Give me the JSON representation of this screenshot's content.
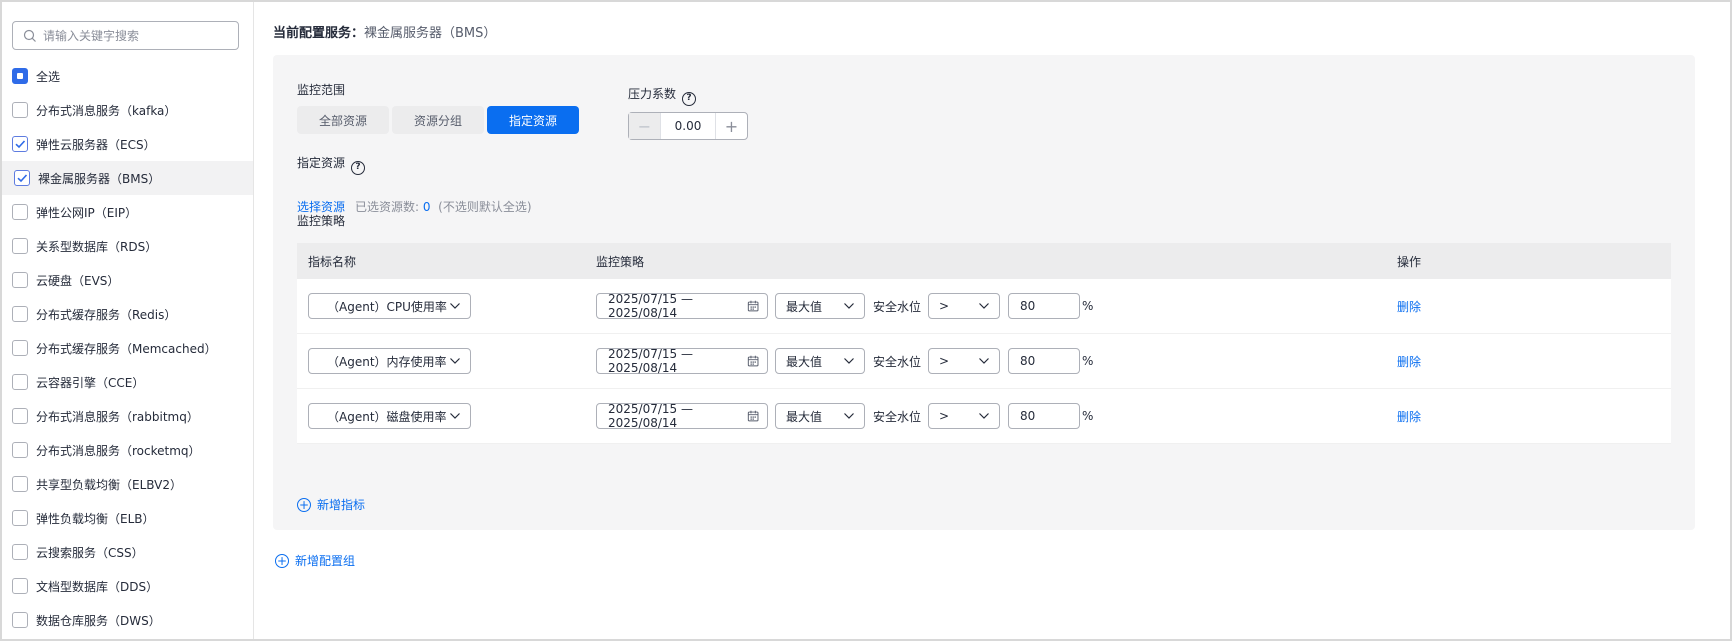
{
  "sidebar": {
    "search_placeholder": "请输入关键字搜索",
    "items": [
      {
        "label": "全选",
        "state": "indeterminate"
      },
      {
        "label": "分布式消息服务（kafka）",
        "state": "unchecked"
      },
      {
        "label": "弹性云服务器（ECS）",
        "state": "checked"
      },
      {
        "label": "裸金属服务器（BMS）",
        "state": "checked"
      },
      {
        "label": "弹性公网IP（EIP）",
        "state": "unchecked"
      },
      {
        "label": "关系型数据库（RDS）",
        "state": "unchecked"
      },
      {
        "label": "云硬盘（EVS）",
        "state": "unchecked"
      },
      {
        "label": "分布式缓存服务（Redis）",
        "state": "unchecked"
      },
      {
        "label": "分布式缓存服务（Memcached）",
        "state": "unchecked"
      },
      {
        "label": "云容器引擎（CCE）",
        "state": "unchecked"
      },
      {
        "label": "分布式消息服务（rabbitmq）",
        "state": "unchecked"
      },
      {
        "label": "分布式消息服务（rocketmq）",
        "state": "unchecked"
      },
      {
        "label": "共享型负载均衡（ELBV2）",
        "state": "unchecked"
      },
      {
        "label": "弹性负载均衡（ELB）",
        "state": "unchecked"
      },
      {
        "label": "云搜索服务（CSS）",
        "state": "unchecked"
      },
      {
        "label": "文档型数据库（DDS）",
        "state": "unchecked"
      },
      {
        "label": "数据仓库服务（DWS）",
        "state": "unchecked"
      }
    ]
  },
  "main": {
    "current_label": "当前配置服务：",
    "current_value": "裸金属服务器（BMS）",
    "scope_label": "监控范围",
    "scope_options": [
      "全部资源",
      "资源分组",
      "指定资源"
    ],
    "scope_active": 2,
    "pressure_label": "压力系数",
    "pressure_value": "0.00",
    "specified_label": "指定资源",
    "select_link": "选择资源",
    "selected_count_label": "已选资源数:",
    "selected_count": "0",
    "selected_hint": "(不选则默认全选)",
    "policy_label": "监控策略",
    "table": {
      "headers": [
        "指标名称",
        "监控策略",
        "操作"
      ],
      "rows": [
        {
          "metric": "（Agent）CPU使用率",
          "date_range": "2025/07/15 — 2025/08/14",
          "agg": "最大值",
          "water_label": "安全水位",
          "op": ">",
          "value": "80",
          "unit": "%",
          "action": "删除"
        },
        {
          "metric": "（Agent）内存使用率",
          "date_range": "2025/07/15 — 2025/08/14",
          "agg": "最大值",
          "water_label": "安全水位",
          "op": ">",
          "value": "80",
          "unit": "%",
          "action": "删除"
        },
        {
          "metric": "（Agent）磁盘使用率",
          "date_range": "2025/07/15 — 2025/08/14",
          "agg": "最大值",
          "water_label": "安全水位",
          "op": ">",
          "value": "80",
          "unit": "%",
          "action": "删除"
        }
      ]
    },
    "add_metric": "新增指标",
    "add_group": "新增配置组"
  },
  "colors": {
    "accent": "#0a6ef0",
    "panel_bg": "#f5f5f6"
  }
}
